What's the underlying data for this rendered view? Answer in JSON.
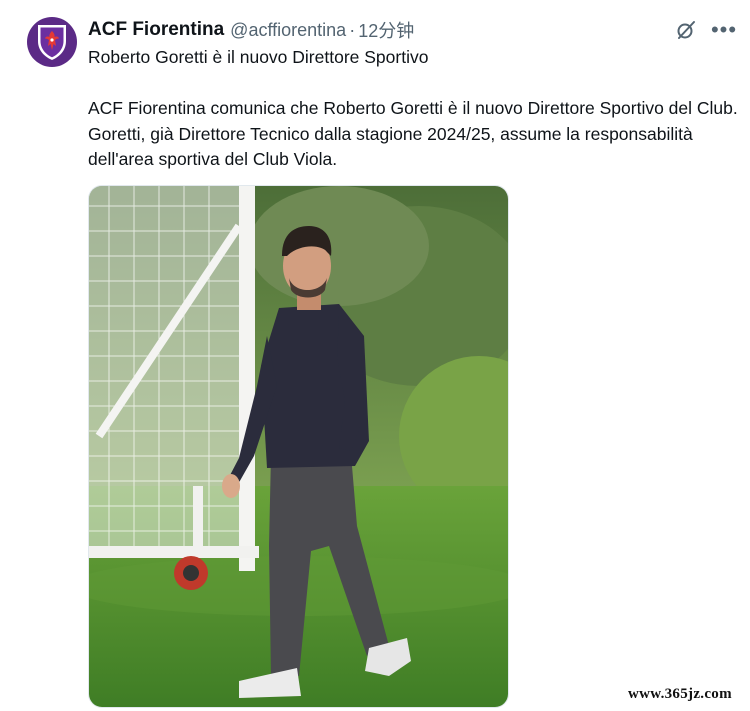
{
  "account": {
    "name": "ACF Fiorentina",
    "handle": "@acffiorentina",
    "separator": "·",
    "time": "12分钟",
    "avatar_icon": "fiorentina-crest-icon",
    "brand_color": "#5b2a86"
  },
  "actions": {
    "grok_icon": "grok-icon",
    "more_icon": "more-options-icon",
    "more_label": "•••"
  },
  "tweet": {
    "headline": "Roberto Goretti è il nuovo Direttore Sportivo",
    "body": "ACF Fiorentina comunica che Roberto Goretti è il nuovo Direttore Sportivo del Club. Goretti, già Direttore Tecnico dalla stagione 2024/25, assume la responsabilità dell'area sportiva del Club Viola."
  },
  "media": {
    "image_icon": "photo-icon"
  },
  "watermark": "www.365jz.com"
}
